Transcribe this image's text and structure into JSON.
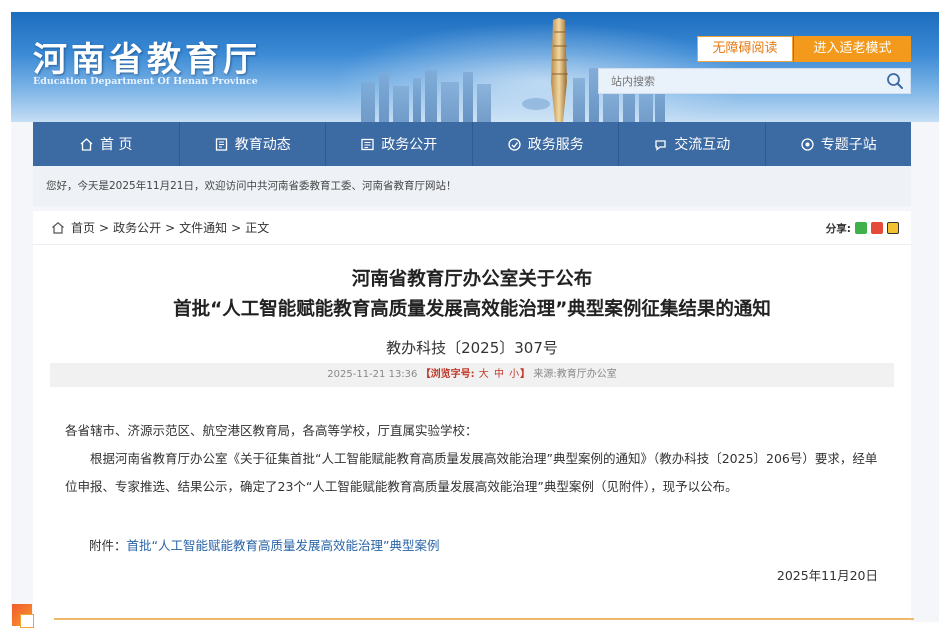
{
  "header": {
    "logo_title": "河南省教育厅",
    "logo_subtitle": "Education Department Of Henan Province",
    "accessibility_button": "无障碍阅读",
    "elder_mode_button": "进入适老模式",
    "search_placeholder": "站内搜索"
  },
  "nav": {
    "items": [
      {
        "label": "首 页",
        "icon": "home-icon"
      },
      {
        "label": "教育动态",
        "icon": "news-icon"
      },
      {
        "label": "政务公开",
        "icon": "document-icon"
      },
      {
        "label": "政务服务",
        "icon": "service-icon"
      },
      {
        "label": "交流互动",
        "icon": "interaction-icon"
      },
      {
        "label": "专题子站",
        "icon": "topic-icon"
      }
    ]
  },
  "welcome_text": "您好，今天是2025年11月21日，欢迎访问中共河南省委教育工委、河南省教育厅网站！",
  "breadcrumb": {
    "items": [
      "首页",
      "政务公开",
      "文件通知",
      "正文"
    ],
    "separator": ">"
  },
  "share": {
    "label": "分享:"
  },
  "article": {
    "title_line1": "河南省教育厅办公室关于公布",
    "title_line2": "首批“人工智能赋能教育高质量发展高效能治理”典型案例征集结果的通知",
    "doc_number": "教办科技〔2025〕307号",
    "meta": {
      "datetime": "2025-11-21 13:36",
      "font_size_label": "【浏览字号:",
      "size_large": "大",
      "size_medium": "中",
      "size_small": "小",
      "font_size_close": "】",
      "source_label": "来源:",
      "source": "教育厅办公室"
    },
    "salutation": "各省辖市、济源示范区、航空港区教育局，各高等学校，厅直属实验学校：",
    "paragraph": "根据河南省教育厅办公室《关于征集首批“人工智能赋能教育高质量发展高效能治理”典型案例的通知》（教办科技〔2025〕206号）要求，经单位申报、专家推选、结果公示，确定了23个“人工智能赋能教育高质量发展高效能治理”典型案例（见附件），现予以公布。",
    "attachment_label": "附件：",
    "attachment_link": "首批“人工智能赋能教育高质量发展高效能治理”典型案例",
    "sign_date": "2025年11月20日"
  },
  "colors": {
    "nav_bg": "#3c6aa3",
    "accent_orange": "#f39a1d",
    "link_blue": "#2a64a8",
    "meta_red": "#c0392b"
  }
}
